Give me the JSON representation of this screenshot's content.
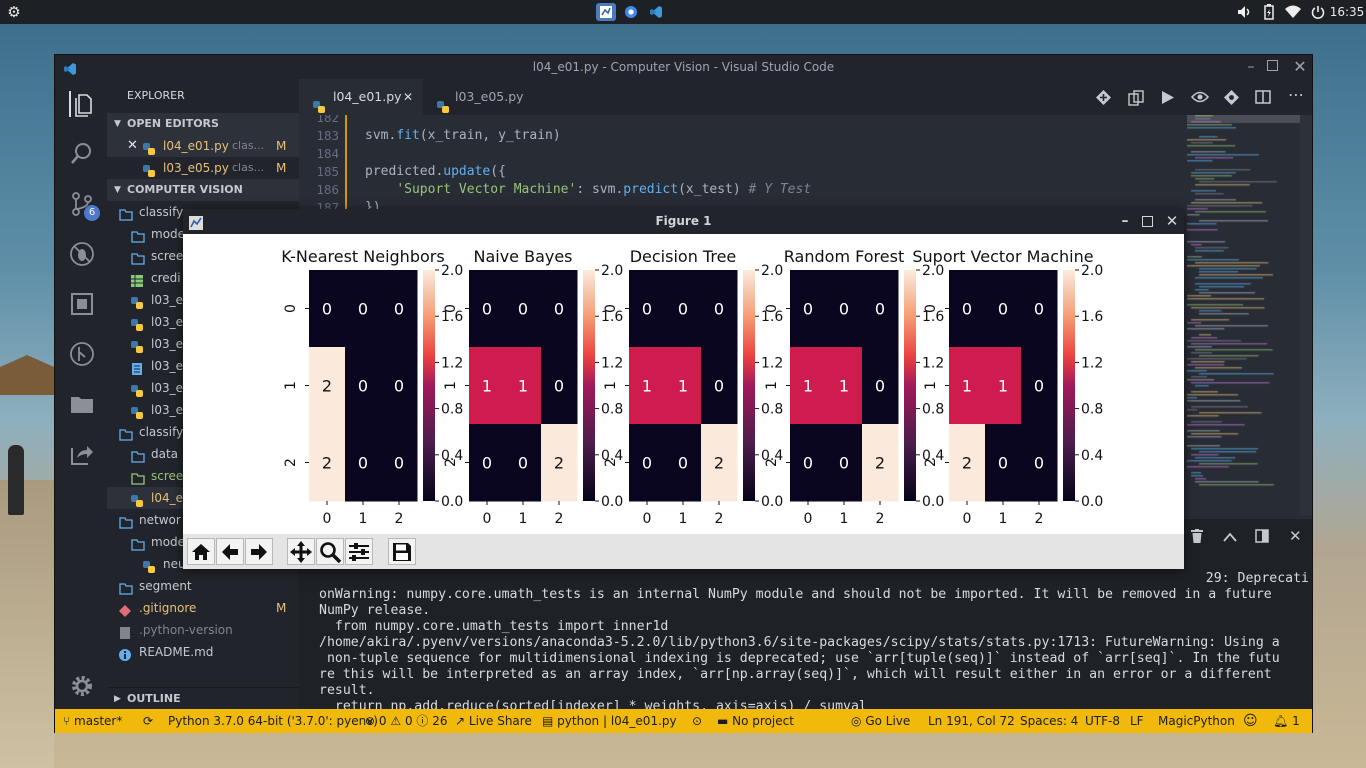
{
  "topbar": {
    "clock": "16:35",
    "tray_icons": [
      "volume-icon",
      "battery-icon",
      "wifi-icon",
      "power-icon"
    ]
  },
  "window": {
    "title": "l04_e01.py - Computer Vision - Visual Studio Code"
  },
  "sidebar": {
    "header": "EXPLORER",
    "open_editors_label": "OPEN EDITORS",
    "open_editors": [
      {
        "name": "l04_e01.py",
        "desc": "clas...",
        "status": "M"
      },
      {
        "name": "l03_e05.py",
        "desc": "clas...",
        "status": "M"
      }
    ],
    "project_label": "COMPUTER VISION",
    "tree": [
      {
        "name": "classify",
        "indent": 0,
        "kind": "folder"
      },
      {
        "name": "mode",
        "indent": 1,
        "kind": "folder"
      },
      {
        "name": "scree",
        "indent": 1,
        "kind": "folder"
      },
      {
        "name": "credi",
        "indent": 1,
        "kind": "csv"
      },
      {
        "name": "l03_e",
        "indent": 1,
        "kind": "py"
      },
      {
        "name": "l03_e",
        "indent": 1,
        "kind": "py"
      },
      {
        "name": "l03_e",
        "indent": 1,
        "kind": "py"
      },
      {
        "name": "l03_e",
        "indent": 1,
        "kind": "txt"
      },
      {
        "name": "l03_e",
        "indent": 1,
        "kind": "py"
      },
      {
        "name": "l03_e",
        "indent": 1,
        "kind": "py"
      },
      {
        "name": "classify",
        "indent": 0,
        "kind": "folder"
      },
      {
        "name": "data",
        "indent": 1,
        "kind": "folder"
      },
      {
        "name": "scree",
        "indent": 1,
        "kind": "folder-green"
      },
      {
        "name": "l04_e",
        "indent": 1,
        "kind": "py-active"
      },
      {
        "name": "networ",
        "indent": 0,
        "kind": "folder"
      },
      {
        "name": "mode",
        "indent": 1,
        "kind": "folder"
      },
      {
        "name": "neu",
        "indent": 2,
        "kind": "py"
      },
      {
        "name": "segment",
        "indent": 0,
        "kind": "folder-closed"
      },
      {
        "name": ".gitignore",
        "indent": 0,
        "kind": "git",
        "status": "M"
      },
      {
        "name": ".python-version",
        "indent": 0,
        "kind": "file"
      },
      {
        "name": "README.md",
        "indent": 0,
        "kind": "info"
      }
    ],
    "outline_label": "OUTLINE",
    "scm_badge": "6"
  },
  "editor": {
    "tabs": [
      {
        "label": "l04_e01.py",
        "active": true
      },
      {
        "label": "l03_e05.py",
        "active": false
      }
    ],
    "lines": [
      {
        "n": "182",
        "text": ""
      },
      {
        "n": "183",
        "text": "svm.fit(x_train, y_train)"
      },
      {
        "n": "184",
        "text": ""
      },
      {
        "n": "185",
        "text": "predicted.update({"
      },
      {
        "n": "186",
        "text": "    'Suport Vector Machine': svm.predict(x_test) # Y Test"
      },
      {
        "n": "187",
        "text": "})"
      }
    ]
  },
  "terminal": {
    "lines": [
      "29: Deprecati",
      "onWarning: numpy.core.umath_tests is an internal NumPy module and should not be imported. It will be removed in a future",
      "NumPy release.",
      "  from numpy.core.umath_tests import inner1d",
      "/home/akira/.pyenv/versions/anaconda3-5.2.0/lib/python3.6/site-packages/scipy/stats/stats.py:1713: FutureWarning: Using a",
      " non-tuple sequence for multidimensional indexing is deprecated; use `arr[tuple(seq)]` instead of `arr[seq]`. In the futu",
      "re this will be interpreted as an array index, `arr[np.array(seq)]`, which will result either in an error or a different",
      "result.",
      "  return np.add.reduce(sorted[indexer] * weights, axis=axis) / sumval"
    ]
  },
  "statusbar": {
    "branch": "master*",
    "python": "Python 3.7.0 64-bit ('3.7.0': pyenv)",
    "errors": "0",
    "warnings": "0",
    "infos": "26",
    "live_share": "Live Share",
    "lang_file": "python | l04_e01.py",
    "project": "No project",
    "go_live": "Go Live",
    "position": "Ln 191, Col 72",
    "spaces": "Spaces: 4",
    "encoding": "UTF-8",
    "eol": "LF",
    "theme": "MagicPython",
    "notifications": "1"
  },
  "figure": {
    "title": "Figure 1",
    "colors": {
      "v0": "#0b0620",
      "v1": "#cd1c4d",
      "v2": "#fbe9dc"
    }
  },
  "chart_data": [
    {
      "type": "heatmap",
      "title": "K-Nearest Neighbors",
      "x_ticks": [
        "0",
        "1",
        "2"
      ],
      "y_ticks": [
        "0",
        "1",
        "2"
      ],
      "values": [
        [
          0,
          0,
          0
        ],
        [
          2,
          0,
          0
        ],
        [
          2,
          0,
          0
        ]
      ],
      "colorbar_ticks": [
        "2.0",
        "1.6",
        "1.2",
        "0.8",
        "0.4",
        "0.0"
      ],
      "vmin": 0,
      "vmax": 2
    },
    {
      "type": "heatmap",
      "title": "Naive Bayes",
      "x_ticks": [
        "0",
        "1",
        "2"
      ],
      "y_ticks": [
        "0",
        "1",
        "2"
      ],
      "values": [
        [
          0,
          0,
          0
        ],
        [
          1,
          1,
          0
        ],
        [
          0,
          0,
          2
        ]
      ],
      "colorbar_ticks": [
        "2.0",
        "1.6",
        "1.2",
        "0.8",
        "0.4",
        "0.0"
      ],
      "vmin": 0,
      "vmax": 2
    },
    {
      "type": "heatmap",
      "title": "Decision Tree",
      "x_ticks": [
        "0",
        "1",
        "2"
      ],
      "y_ticks": [
        "0",
        "1",
        "2"
      ],
      "values": [
        [
          0,
          0,
          0
        ],
        [
          1,
          1,
          0
        ],
        [
          0,
          0,
          2
        ]
      ],
      "colorbar_ticks": [
        "2.0",
        "1.6",
        "1.2",
        "0.8",
        "0.4",
        "0.0"
      ],
      "vmin": 0,
      "vmax": 2
    },
    {
      "type": "heatmap",
      "title": "Random Forest",
      "x_ticks": [
        "0",
        "1",
        "2"
      ],
      "y_ticks": [
        "0",
        "1",
        "2"
      ],
      "values": [
        [
          0,
          0,
          0
        ],
        [
          1,
          1,
          0
        ],
        [
          0,
          0,
          2
        ]
      ],
      "colorbar_ticks": [
        "2.0",
        "1.6",
        "1.2",
        "0.8",
        "0.4",
        "0.0"
      ],
      "vmin": 0,
      "vmax": 2
    },
    {
      "type": "heatmap",
      "title": "Suport Vector Machine",
      "x_ticks": [
        "0",
        "1",
        "2"
      ],
      "y_ticks": [
        "0",
        "1",
        "2"
      ],
      "values": [
        [
          0,
          0,
          0
        ],
        [
          1,
          1,
          0
        ],
        [
          2,
          0,
          0
        ]
      ],
      "colorbar_ticks": [
        "2.0",
        "1.6",
        "1.2",
        "0.8",
        "0.4",
        "0.0"
      ],
      "vmin": 0,
      "vmax": 2
    }
  ]
}
